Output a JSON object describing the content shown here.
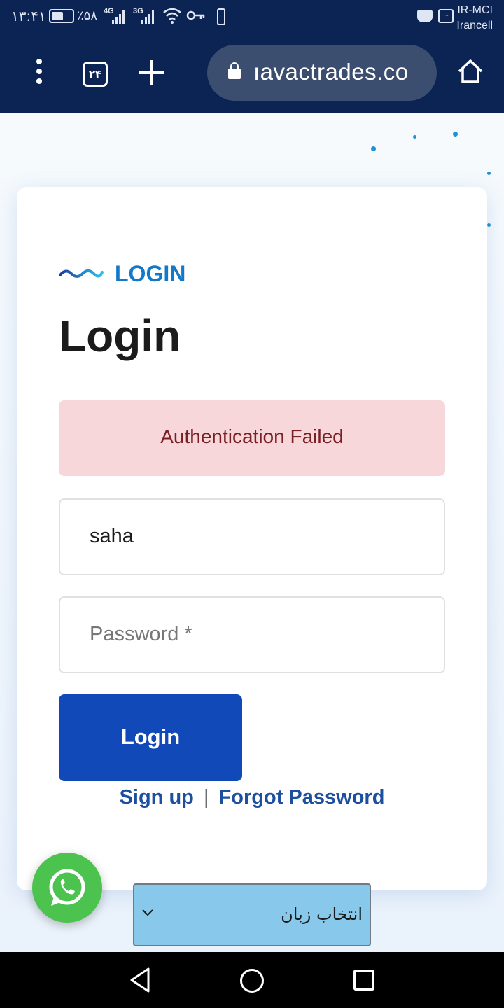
{
  "status_bar": {
    "time": "۱۳:۴۱",
    "battery": "٪۵۸",
    "network_1": "4G",
    "network_2": "3G",
    "carrier_1": "IR-MCI",
    "carrier_2": "Irancell",
    "icons": [
      "battery-icon",
      "signal-icon",
      "wifi-icon",
      "key-icon",
      "vibrate-icon",
      "shop-icon",
      "activity-icon"
    ]
  },
  "browser": {
    "tab_count": "۲۴",
    "url": "ıavactrades.co"
  },
  "login": {
    "eyebrow": "LOGIN",
    "title": "Login",
    "alert": "Authentication Failed",
    "username_value": "saha",
    "password_placeholder": "Password *",
    "login_button": "Login",
    "signup_link": "Sign up",
    "separator": "|",
    "forgot_link": "Forgot Password"
  },
  "language_select": {
    "selected": "انتخاب زبان"
  },
  "colors": {
    "header_bg": "#0b2454",
    "accent": "#1378c8",
    "button": "#1249b8",
    "alert_bg": "#f8d7da",
    "alert_text": "#7a1f24",
    "whatsapp": "#4cc24f",
    "lang_bg": "#88c9eb"
  }
}
